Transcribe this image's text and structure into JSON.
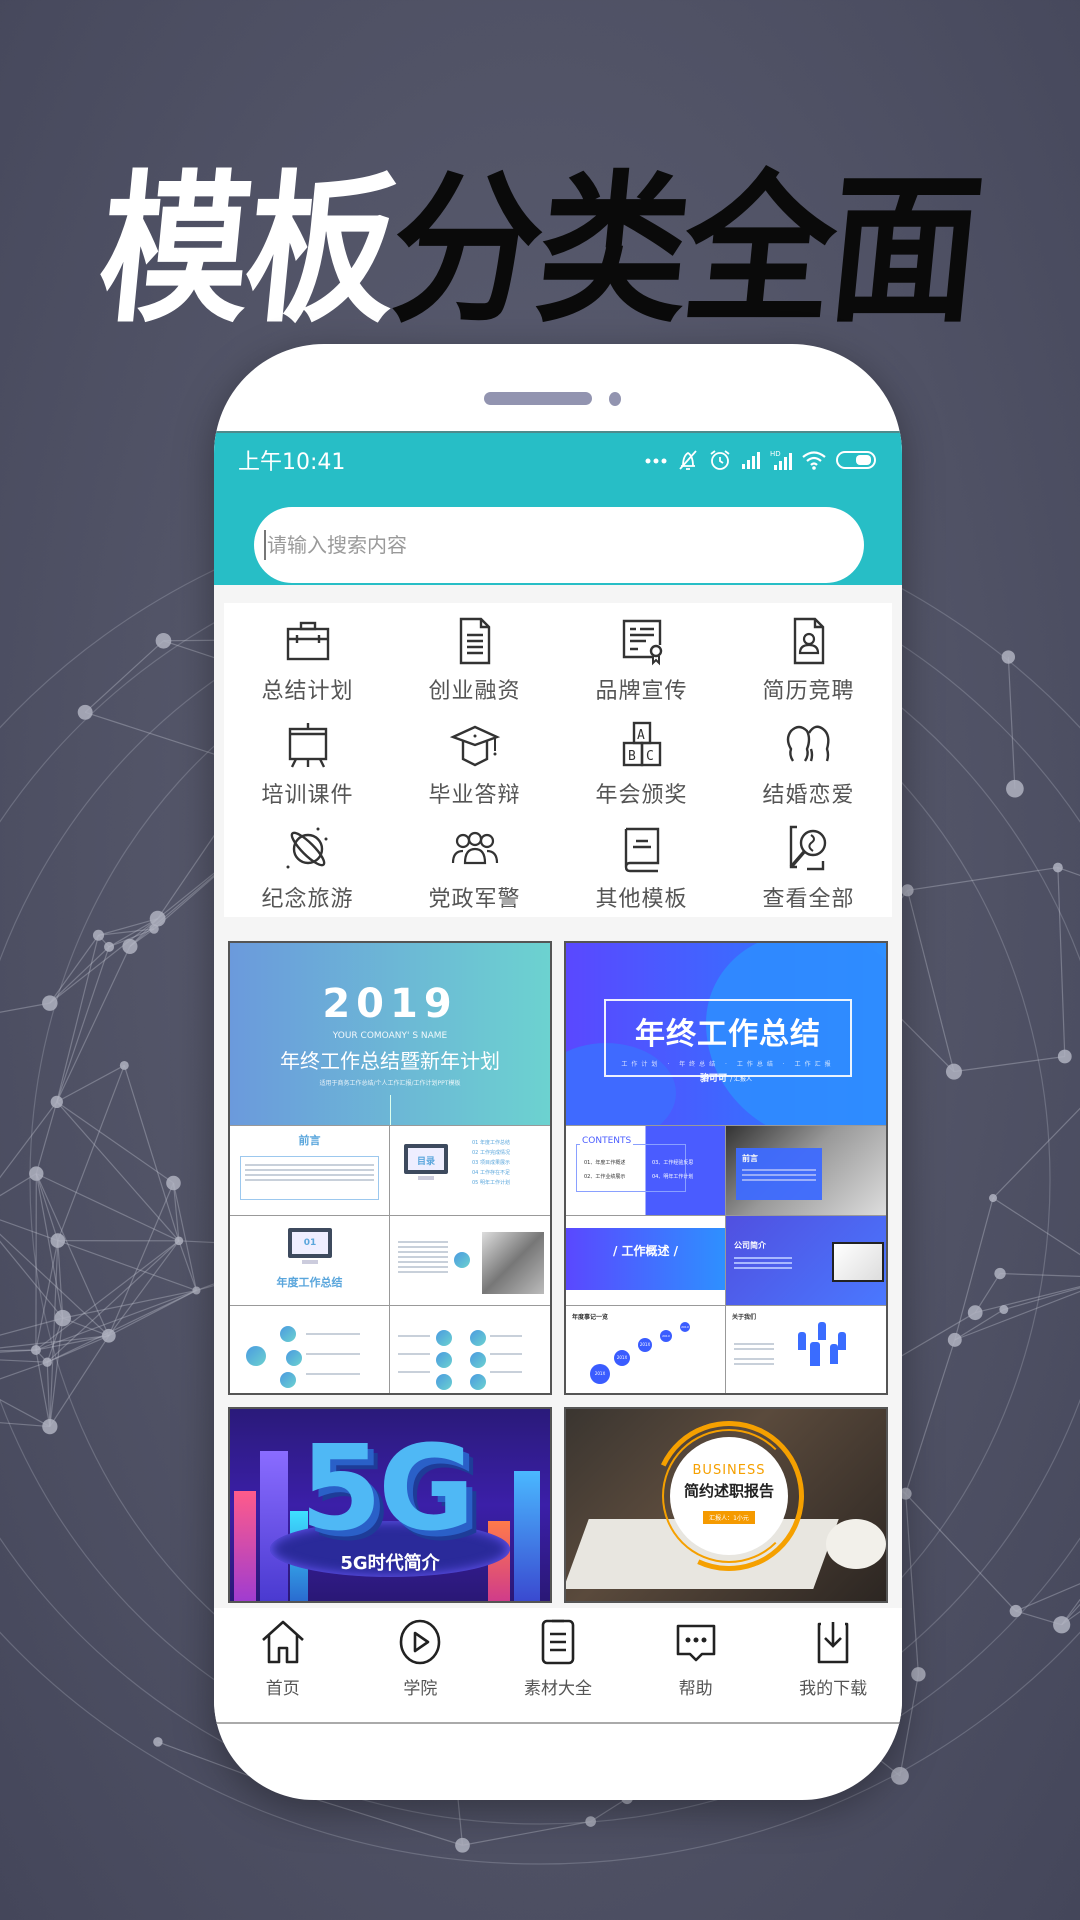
{
  "headline": {
    "white_part": "模板",
    "black_part": "分类全面"
  },
  "status_bar": {
    "time": "上午10:41",
    "icons": [
      "more-dots-icon",
      "mute-bell-icon",
      "alarm-icon",
      "signal-icon",
      "hd-signal-icon",
      "wifi-icon",
      "battery-icon"
    ]
  },
  "search": {
    "placeholder": "请输入搜索内容",
    "value": ""
  },
  "categories": [
    {
      "label": "总结计划",
      "icon": "briefcase-icon"
    },
    {
      "label": "创业融资",
      "icon": "document-icon"
    },
    {
      "label": "品牌宣传",
      "icon": "certificate-icon"
    },
    {
      "label": "简历竞聘",
      "icon": "resume-icon"
    },
    {
      "label": "培训课件",
      "icon": "easel-icon"
    },
    {
      "label": "毕业答辩",
      "icon": "graduation-cap-icon"
    },
    {
      "label": "年会颁奖",
      "icon": "abc-blocks-icon"
    },
    {
      "label": "结婚恋爱",
      "icon": "couple-icon"
    },
    {
      "label": "纪念旅游",
      "icon": "planet-icon"
    },
    {
      "label": "党政军警",
      "icon": "group-icon"
    },
    {
      "label": "其他模板",
      "icon": "book-icon"
    },
    {
      "label": "查看全部",
      "icon": "search-all-icon"
    }
  ],
  "templates": [
    {
      "year": "2019",
      "company": "YOUR COMOANY' S NAME",
      "title": "年终工作总结暨新年计划",
      "subtitle": "适用于商务工作总结/个人工作汇报/工作计划PPT模板",
      "slides": {
        "preface": "前言",
        "toc": "目录",
        "section_no": "01",
        "section_title": "年度工作总结",
        "toc_items": [
          "01 年度工作总结",
          "02 工作完成情况",
          "03 项目成果展示",
          "04 工作存在不足",
          "05 明年工作计划"
        ]
      }
    },
    {
      "title": "年终工作总结",
      "subtitle": "工作计划 · 年终总结 · 工作总结 · 工作汇报",
      "presenter": "骆可可",
      "presenter_role": "/ 汇报人",
      "slides": {
        "contents": "CONTENTS",
        "contents_items": [
          "01、年度工作概述",
          "02、工作业绩展示",
          "03、工作经验反思",
          "04、明年工作计划"
        ],
        "preface": "前言",
        "overview": "/ 工作概述 /",
        "company_intro": "公司简介",
        "events": "年度事记一览",
        "about": "关于我们",
        "timeline_labels": [
          "201X",
          "201X",
          "201X",
          "201X",
          "201X"
        ]
      }
    },
    {
      "big_text": "5G",
      "title": "5G时代简介"
    },
    {
      "en_title": "BUSINESS",
      "title": "简约述职报告",
      "tag": "汇报人：1小元"
    }
  ],
  "tabbar": [
    {
      "label": "首页",
      "icon": "home-icon"
    },
    {
      "label": "学院",
      "icon": "play-circle-icon"
    },
    {
      "label": "素材大全",
      "icon": "clipboard-list-icon"
    },
    {
      "label": "帮助",
      "icon": "chat-bubble-icon"
    },
    {
      "label": "我的下载",
      "icon": "download-icon"
    }
  ],
  "colors": {
    "accent": "#27bec6",
    "background": "#545669",
    "orange": "#f5a000"
  }
}
